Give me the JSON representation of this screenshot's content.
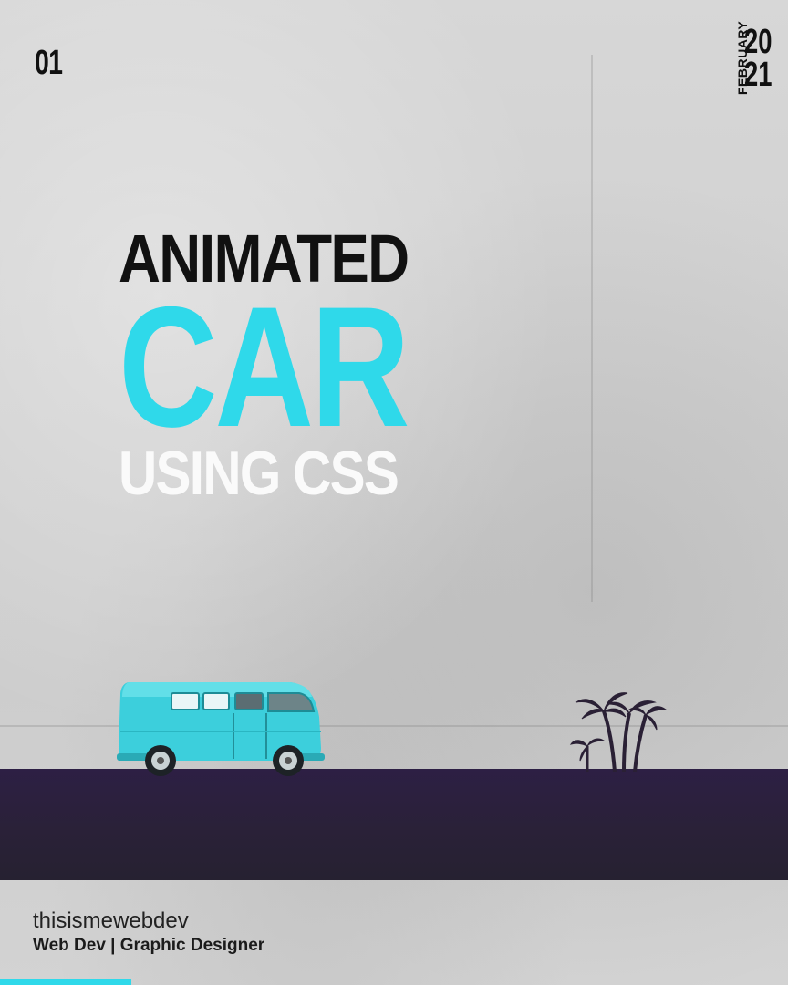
{
  "slide_number": "01",
  "date": {
    "month": "FEBRUARY",
    "year_line1": "20",
    "year_line2": "21"
  },
  "title": {
    "line1": "ANIMATED",
    "line2": "CAR",
    "line3": "USING CSS"
  },
  "footer": {
    "handle": "thisismewebdev",
    "role": "Web Dev | Graphic Designer"
  },
  "colors": {
    "accent": "#2fd9ea",
    "road": "#2b1f3f",
    "text_dark": "#111111"
  },
  "icons": {
    "vehicle": "van-illustration",
    "scenery": "palm-trees-illustration"
  }
}
